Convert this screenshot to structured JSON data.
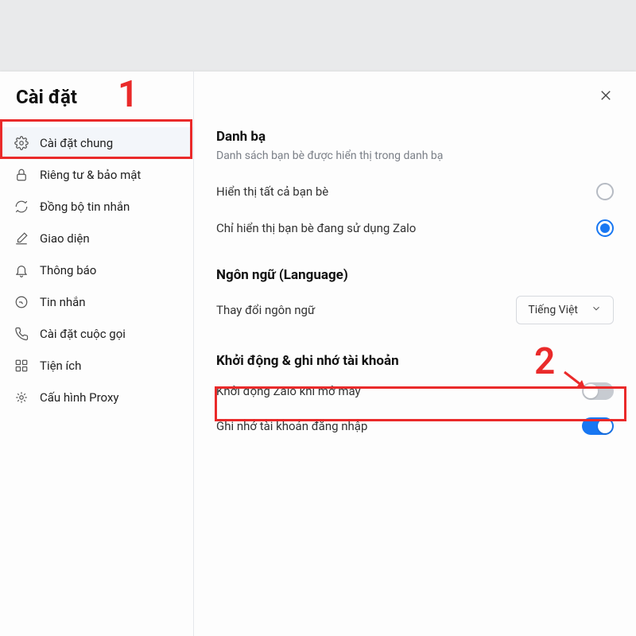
{
  "title": "Cài đặt",
  "sidebar": {
    "items": [
      {
        "label": "Cài đặt chung"
      },
      {
        "label": "Riêng tư & bảo mật"
      },
      {
        "label": "Đồng bộ tin nhắn"
      },
      {
        "label": "Giao diện"
      },
      {
        "label": "Thông báo"
      },
      {
        "label": "Tin nhắn"
      },
      {
        "label": "Cài đặt cuộc gọi"
      },
      {
        "label": "Tiện ích"
      },
      {
        "label": "Cấu hình Proxy"
      }
    ]
  },
  "contacts": {
    "title": "Danh bạ",
    "sub": "Danh sách bạn bè được hiển thị trong danh bạ",
    "opt1": "Hiển thị tất cả bạn bè",
    "opt2": "Chỉ hiển thị bạn bè đang sử dụng Zalo"
  },
  "language": {
    "title": "Ngôn ngữ (Language)",
    "label": "Thay đổi ngôn ngữ",
    "value": "Tiếng Việt"
  },
  "startup": {
    "title": "Khởi động & ghi nhớ tài khoản",
    "row1": "Khởi động Zalo khi mở máy",
    "row2": "Ghi nhớ tài khoản đăng nhập"
  },
  "annotations": {
    "num1": "1",
    "num2": "2"
  }
}
